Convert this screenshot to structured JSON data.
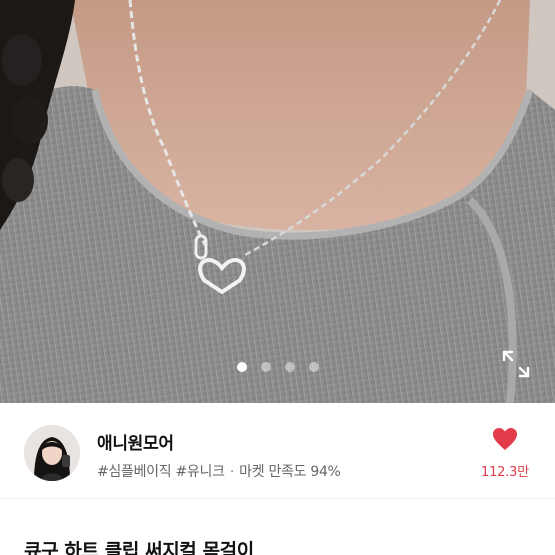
{
  "product": {
    "image_count": 4,
    "active_image_index": 0,
    "title": "큐구 하트 클립 써지컬 목걸이"
  },
  "seller": {
    "name": "애니원모어",
    "tags": [
      "#심플베이직",
      "#유니크"
    ],
    "separator": "·",
    "satisfaction": "마켓 만족도 94%"
  },
  "likes": {
    "count": "112.3만",
    "liked": true,
    "color": "#e23c4b"
  },
  "icons": {
    "expand": "expand-icon",
    "heart": "heart-icon"
  }
}
